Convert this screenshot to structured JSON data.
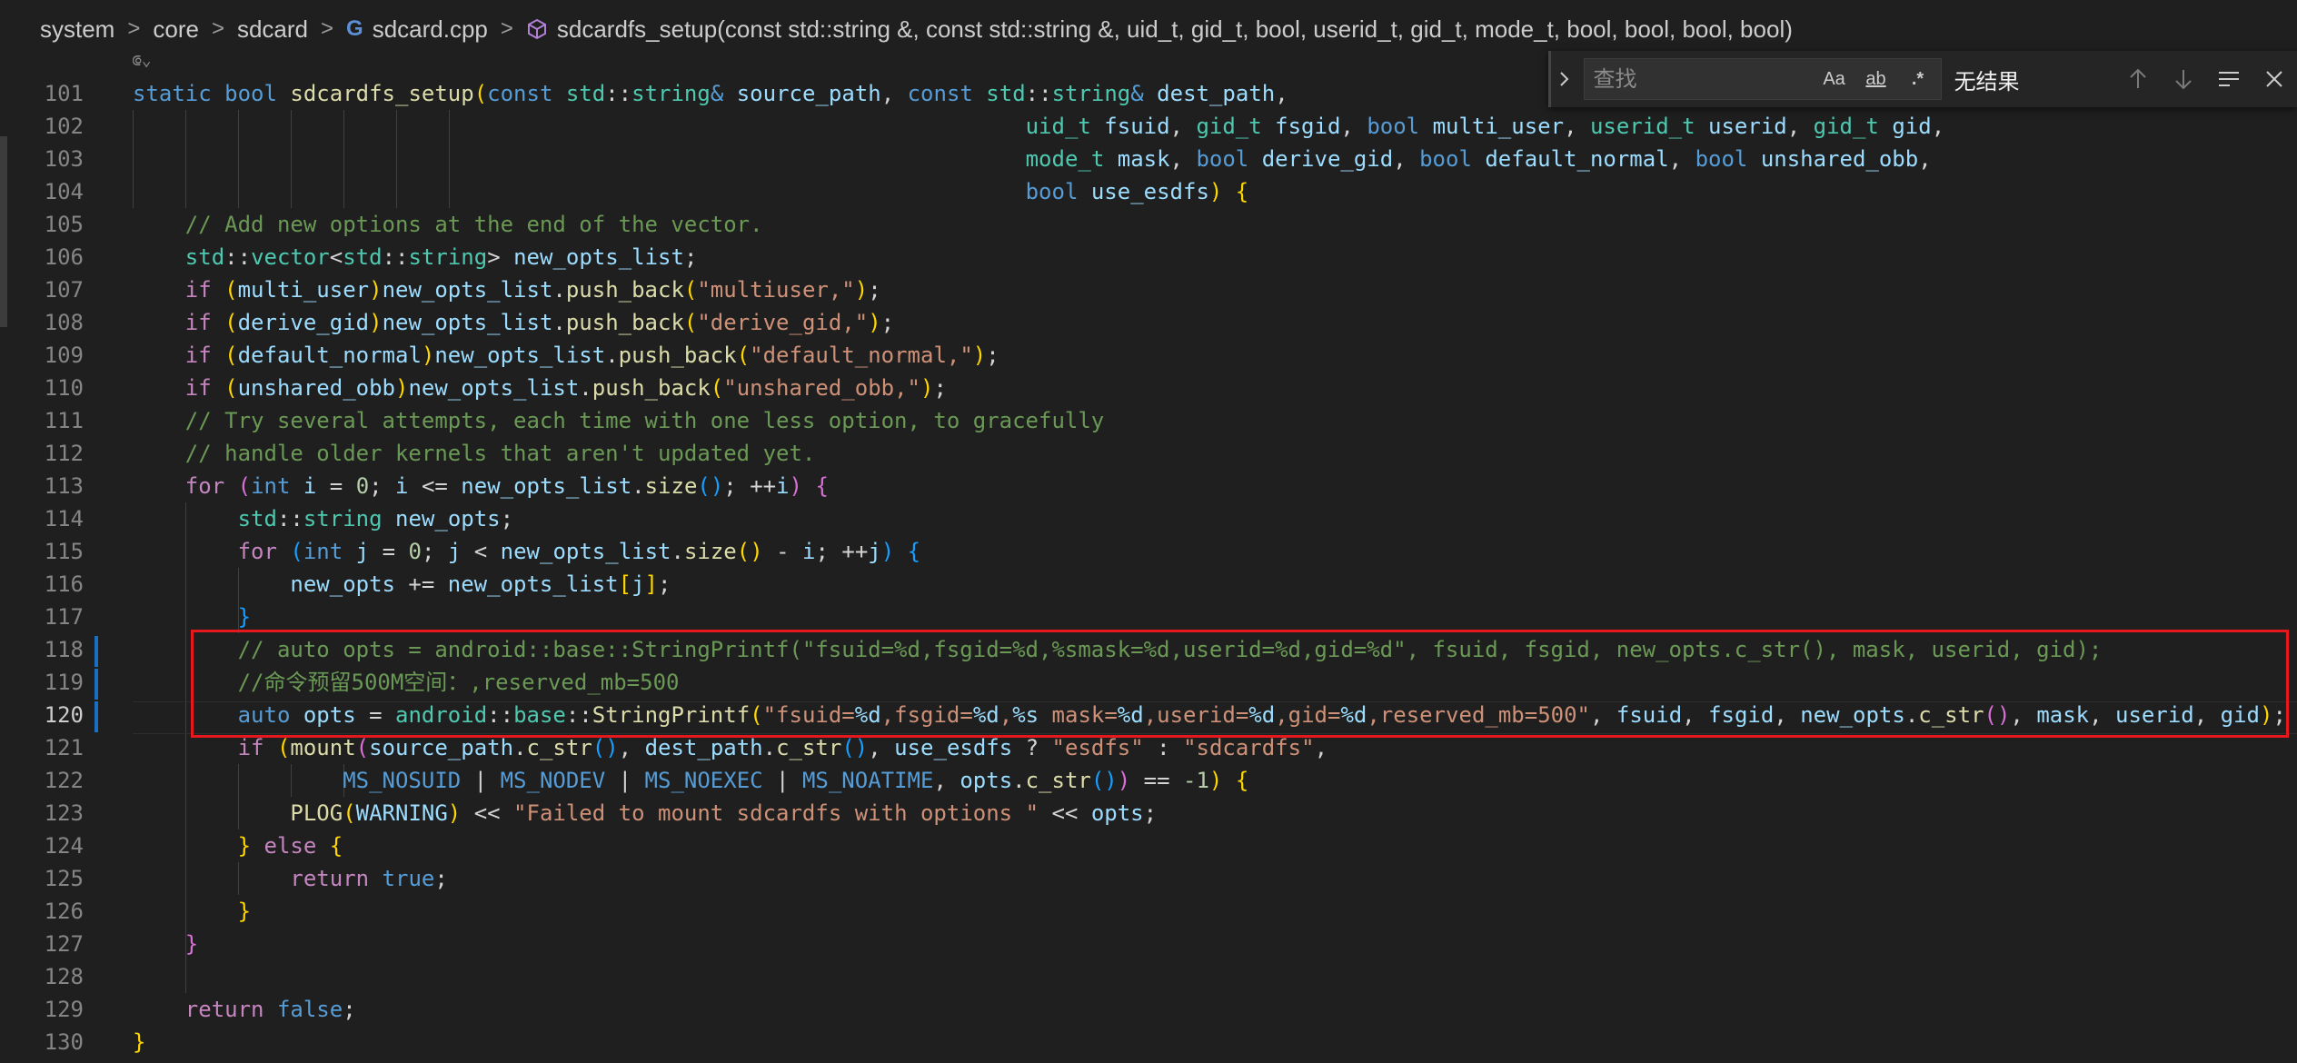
{
  "breadcrumb": {
    "items": [
      "system",
      "core",
      "sdcard",
      "sdcard.cpp",
      "sdcardfs_setup(const std::string &, const std::string &, uid_t, gid_t, bool, userid_t, gid_t, mode_t, bool, bool, bool, bool)"
    ],
    "separator": ">"
  },
  "find_widget": {
    "placeholder": "查找",
    "match_case_label": "Aa",
    "whole_word_label": "ab",
    "regex_label": ".*",
    "status": "无结果"
  },
  "sticky_peek": "⟃⌄",
  "line_numbers": [
    "101",
    "102",
    "103",
    "104",
    "105",
    "106",
    "107",
    "108",
    "109",
    "110",
    "111",
    "112",
    "113",
    "114",
    "115",
    "116",
    "117",
    "118",
    "119",
    "120",
    "121",
    "122",
    "123",
    "124",
    "125",
    "126",
    "127",
    "128",
    "129",
    "130"
  ],
  "code": {
    "l101": [
      "static",
      "bool",
      "sdcardfs_setup",
      "(",
      "const",
      "std",
      "::",
      "string",
      "&",
      "source_path",
      ", ",
      "const",
      "std",
      "::",
      "string",
      "&",
      "dest_path",
      ","
    ],
    "l102": [
      "uid_t",
      "fsuid",
      ", ",
      "gid_t",
      "fsgid",
      ", ",
      "bool",
      "multi_user",
      ", ",
      "userid_t",
      "userid",
      ", ",
      "gid_t",
      "gid",
      ","
    ],
    "l103": [
      "mode_t",
      "mask",
      ", ",
      "bool",
      "derive_gid",
      ", ",
      "bool",
      "default_normal",
      ", ",
      "bool",
      "unshared_obb",
      ","
    ],
    "l104": [
      "bool",
      "use_esdfs",
      ")",
      "{"
    ],
    "l105": "// Add new options at the end of the vector.",
    "l106": [
      "std",
      "::",
      "vector",
      "<",
      "std",
      "::",
      "string",
      ">",
      "new_opts_list",
      ";"
    ],
    "l107": [
      "if",
      "(",
      "multi_user",
      ")",
      "new_opts_list",
      ".",
      "push_back",
      "(",
      "\"multiuser,\"",
      ")",
      ";"
    ],
    "l108": [
      "if",
      "(",
      "derive_gid",
      ")",
      "new_opts_list",
      ".",
      "push_back",
      "(",
      "\"derive_gid,\"",
      ")",
      ";"
    ],
    "l109": [
      "if",
      "(",
      "default_normal",
      ")",
      "new_opts_list",
      ".",
      "push_back",
      "(",
      "\"default_normal,\"",
      ")",
      ";"
    ],
    "l110": [
      "if",
      "(",
      "unshared_obb",
      ")",
      "new_opts_list",
      ".",
      "push_back",
      "(",
      "\"unshared_obb,\"",
      ")",
      ";"
    ],
    "l111": "// Try several attempts, each time with one less option, to gracefully",
    "l112": "// handle older kernels that aren't updated yet.",
    "l113": [
      "for",
      "(",
      "int",
      "i",
      " = ",
      "0",
      "; ",
      "i",
      " <= ",
      "new_opts_list",
      ".",
      "size",
      "()",
      "; ++",
      "i",
      ")",
      "{"
    ],
    "l114": [
      "std",
      "::",
      "string",
      "new_opts",
      ";"
    ],
    "l115": [
      "for",
      "(",
      "int",
      "j",
      " = ",
      "0",
      "; ",
      "j",
      " < ",
      "new_opts_list",
      ".",
      "size",
      "()",
      " - ",
      "i",
      "; ++",
      "j",
      ")",
      "{"
    ],
    "l116": [
      "new_opts",
      " += ",
      "new_opts_list",
      "[",
      "j",
      "]",
      ";"
    ],
    "l117": [
      "}"
    ],
    "l118": "// auto opts = android::base::StringPrintf(\"fsuid=%d,fsgid=%d,%smask=%d,userid=%d,gid=%d\", fsuid, fsgid, new_opts.c_str(), mask, userid, gid);",
    "l119": "//命令预留500M空间：,reserved_mb=500",
    "l120": [
      "auto",
      "opts",
      " = ",
      "android",
      "::",
      "base",
      "::",
      "StringPrintf",
      "(",
      "\"fsuid=",
      "%d",
      ",fsgid=",
      "%d",
      ",",
      "%s",
      "mask=",
      "%d",
      ",userid=",
      "%d",
      ",gid=",
      "%d",
      ",reserved_mb=500\"",
      ", ",
      "fsuid",
      ", ",
      "fsgid",
      ", ",
      "new_opts",
      ".",
      "c_str",
      "()",
      ", ",
      "mask",
      ", ",
      "userid",
      ", ",
      "gid",
      ")",
      ";"
    ],
    "l121": [
      "if",
      "(",
      "mount",
      "(",
      "source_path",
      ".",
      "c_str",
      "()",
      ", ",
      "dest_path",
      ".",
      "c_str",
      "()",
      ", ",
      "use_esdfs",
      " ? ",
      "\"esdfs\"",
      " : ",
      "\"sdcardfs\"",
      ","
    ],
    "l122": [
      "MS_NOSUID",
      " | ",
      "MS_NODEV",
      " | ",
      "MS_NOEXEC",
      " | ",
      "MS_NOATIME",
      ", ",
      "opts",
      ".",
      "c_str",
      "()",
      ")",
      " == ",
      "-1",
      ")",
      "{"
    ],
    "l123": [
      "PLOG",
      "(",
      "WARNING",
      ")",
      " << ",
      "\"Failed to mount sdcardfs with options \"",
      " << ",
      "opts",
      ";"
    ],
    "l124": [
      "}",
      " else ",
      "{"
    ],
    "l125": [
      "return",
      "true",
      ";"
    ],
    "l126": [
      "}"
    ],
    "l127": [
      "}"
    ],
    "l128": [],
    "l129": [
      "return",
      "false",
      ";"
    ],
    "l130": [
      "}"
    ]
  },
  "colors": {
    "background": "#1f1f1f",
    "keyword": "#569cd6",
    "control": "#c586c0",
    "function": "#dcdcaa",
    "type": "#4ec9b0",
    "variable": "#9cdcfe",
    "string": "#ce9178",
    "number": "#b5cea8",
    "comment": "#6a9955",
    "highlight_box": "#e5191d",
    "modified_gutter": "#1b6fc2"
  },
  "active_line": "120"
}
